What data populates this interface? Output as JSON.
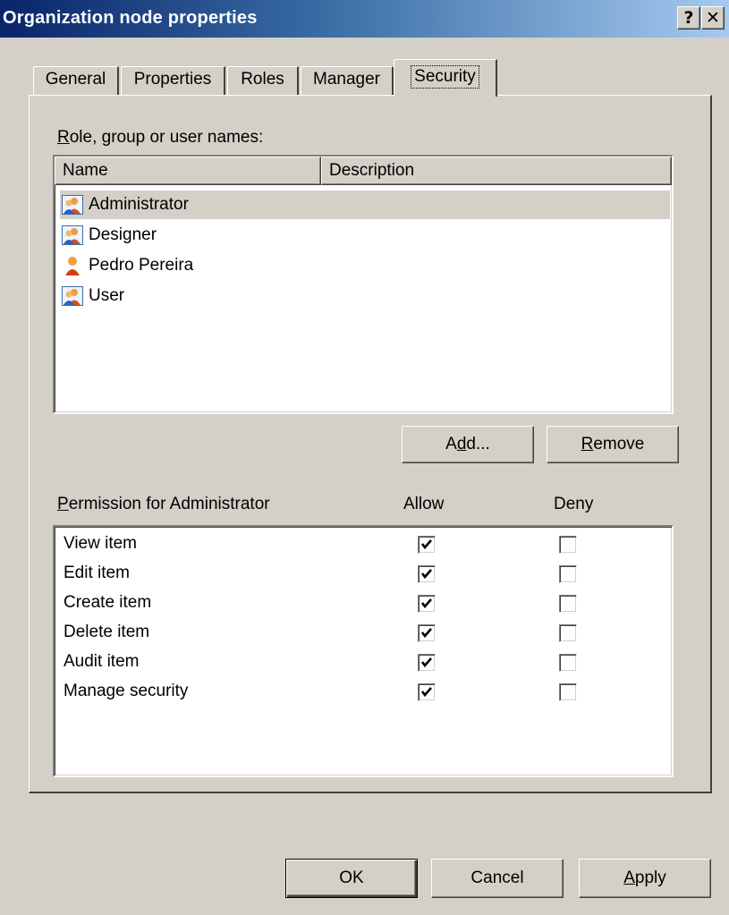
{
  "window": {
    "title": "Organization node properties",
    "help_glyph": "?",
    "close_glyph": "✕"
  },
  "tabs": [
    {
      "label": "General",
      "active": false
    },
    {
      "label": "Properties",
      "active": false
    },
    {
      "label": "Roles",
      "active": false
    },
    {
      "label": "Manager",
      "active": false
    },
    {
      "label": "Security",
      "active": true
    }
  ],
  "names_section": {
    "label_accel": "R",
    "label_rest": "ole, group or user names:",
    "columns": [
      "Name",
      "Description"
    ],
    "items": [
      {
        "name": "Administrator",
        "description": "",
        "icon": "group-icon",
        "selected": true
      },
      {
        "name": "Designer",
        "description": "",
        "icon": "group-icon",
        "selected": false
      },
      {
        "name": "Pedro Pereira",
        "description": "",
        "icon": "user-icon",
        "selected": false
      },
      {
        "name": "User",
        "description": "",
        "icon": "group-icon",
        "selected": false
      }
    ]
  },
  "buttons": {
    "add": {
      "pre": "A",
      "accel": "d",
      "post": "d..."
    },
    "remove": {
      "pre": "",
      "accel": "R",
      "post": "emove"
    }
  },
  "permissions": {
    "header_accel": "P",
    "header_rest": "ermission for Administrator",
    "allow_label": "Allow",
    "deny_label": "Deny",
    "items": [
      {
        "label": "View item",
        "allow": true,
        "deny": false
      },
      {
        "label": "Edit item",
        "allow": true,
        "deny": false
      },
      {
        "label": "Create item",
        "allow": true,
        "deny": false
      },
      {
        "label": "Delete item",
        "allow": true,
        "deny": false
      },
      {
        "label": "Audit item",
        "allow": true,
        "deny": false
      },
      {
        "label": "Manage security",
        "allow": true,
        "deny": false
      }
    ]
  },
  "footer": {
    "ok": "OK",
    "cancel": "Cancel",
    "apply_accel": "A",
    "apply_rest": "pply"
  }
}
